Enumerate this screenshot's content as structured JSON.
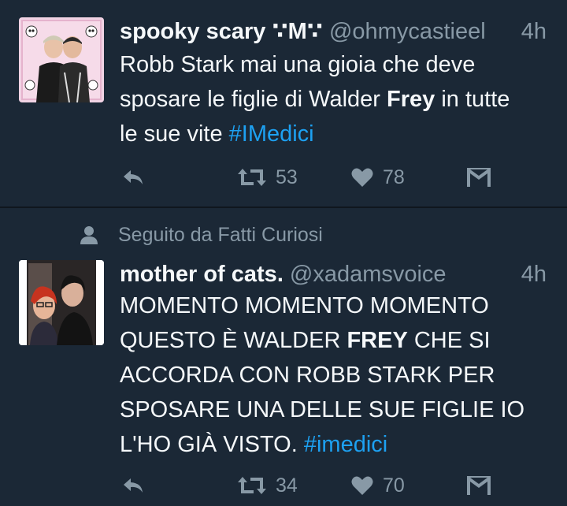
{
  "tweets": [
    {
      "name": "spooky scary ∵M∵",
      "handle": "@ohmycastieel",
      "time": "4h",
      "text_lines": [
        [
          "Robb Stark mai una gioia che deve"
        ],
        [
          "sposare le figlie di Walder ",
          "Frey",
          " in tutte"
        ],
        [
          "le sue vite ",
          "#IMedici"
        ]
      ],
      "retweets": "53",
      "likes": "78"
    },
    {
      "name": "mother of cats.",
      "handle": "@xadamsvoice",
      "time": "4h",
      "text_lines": [
        [
          "MOMENTO MOMENTO MOMENTO"
        ],
        [
          "QUESTO È WALDER ",
          "FREY",
          " CHE SI"
        ],
        [
          "ACCORDA CON ROBB STARK PER"
        ],
        [
          "SPOSARE UNA DELLE SUE FIGLIE IO"
        ],
        [
          "L'HO GIÀ VISTO. ",
          "#imedici"
        ]
      ],
      "retweets": "34",
      "likes": "70"
    }
  ],
  "followed_by": "Seguito da Fatti Curiosi",
  "colors": {
    "background": "#1b2836",
    "accent": "#1da1f2",
    "muted": "#8899a6"
  },
  "icons": [
    "reply-icon",
    "retweet-icon",
    "like-icon",
    "direct-message-icon",
    "person-icon"
  ]
}
